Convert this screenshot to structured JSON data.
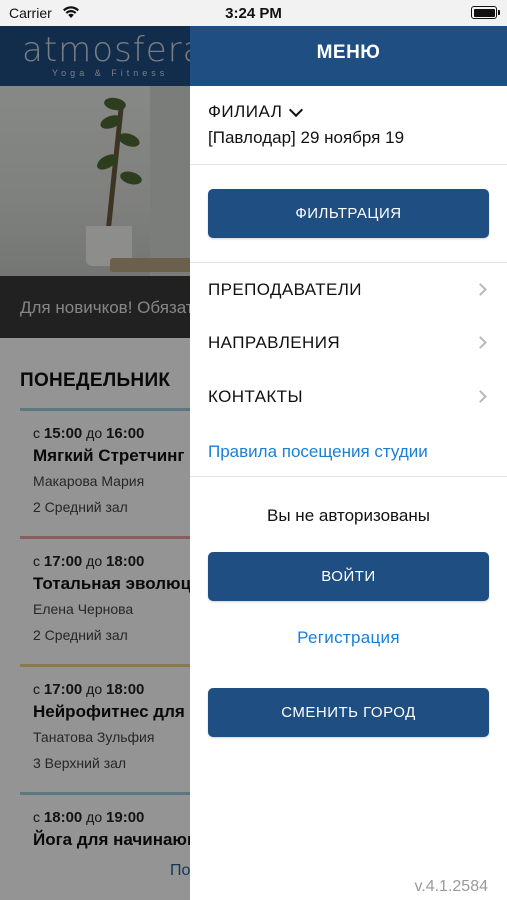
{
  "status_bar": {
    "carrier": "Carrier",
    "time": "3:24 PM"
  },
  "background": {
    "logo": "atmosfera",
    "logo_sub": "Yoga & Fitness",
    "banner": "Для новичков! Обязательная",
    "day": "ПОНЕДЕЛЬНИК",
    "classes": [
      {
        "from_word": "с",
        "start": "15:00",
        "to_word": "до",
        "end": "16:00",
        "title": "Мягкий Стретчинг",
        "teacher": "Макарова Мария",
        "room": "2 Средний зал",
        "accent": "#9ccfd8"
      },
      {
        "from_word": "с",
        "start": "17:00",
        "to_word": "до",
        "end": "18:00",
        "title": "Тотальная эволюция",
        "teacher": "Елена Чернова",
        "room": "2 Средний зал",
        "accent": "#e7a3a3"
      },
      {
        "from_word": "с",
        "start": "17:00",
        "to_word": "до",
        "end": "18:00",
        "title": "Нейрофитнес для",
        "teacher": "Танатова Зульфия",
        "room": "3 Верхний зал",
        "accent": "#e9d08a"
      },
      {
        "from_word": "с",
        "start": "18:00",
        "to_word": "до",
        "end": "19:00",
        "title": "Йога для начинающих",
        "teacher": "",
        "room": "",
        "accent": "#9ccfd8"
      }
    ],
    "bottom_link": "По"
  },
  "menu": {
    "title": "МЕНЮ",
    "branch_label": "ФИЛИАЛ",
    "branch_value": "[Павлодар] 29 ноября 19",
    "filter_button": "ФИЛЬТРАЦИЯ",
    "nav": [
      {
        "label": "ПРЕПОДАВАТЕЛИ"
      },
      {
        "label": "НАПРАВЛЕНИЯ"
      },
      {
        "label": "КОНТАКТЫ"
      }
    ],
    "rules_link": "Правила посещения студии",
    "auth_status": "Вы не авторизованы",
    "login_button": "ВОЙТИ",
    "register_link": "Регистрация",
    "change_city_button": "СМЕНИТЬ ГОРОД",
    "version": "v.4.1.2584"
  },
  "colors": {
    "brand": "#1f4e82",
    "link": "#1a7fd6"
  }
}
